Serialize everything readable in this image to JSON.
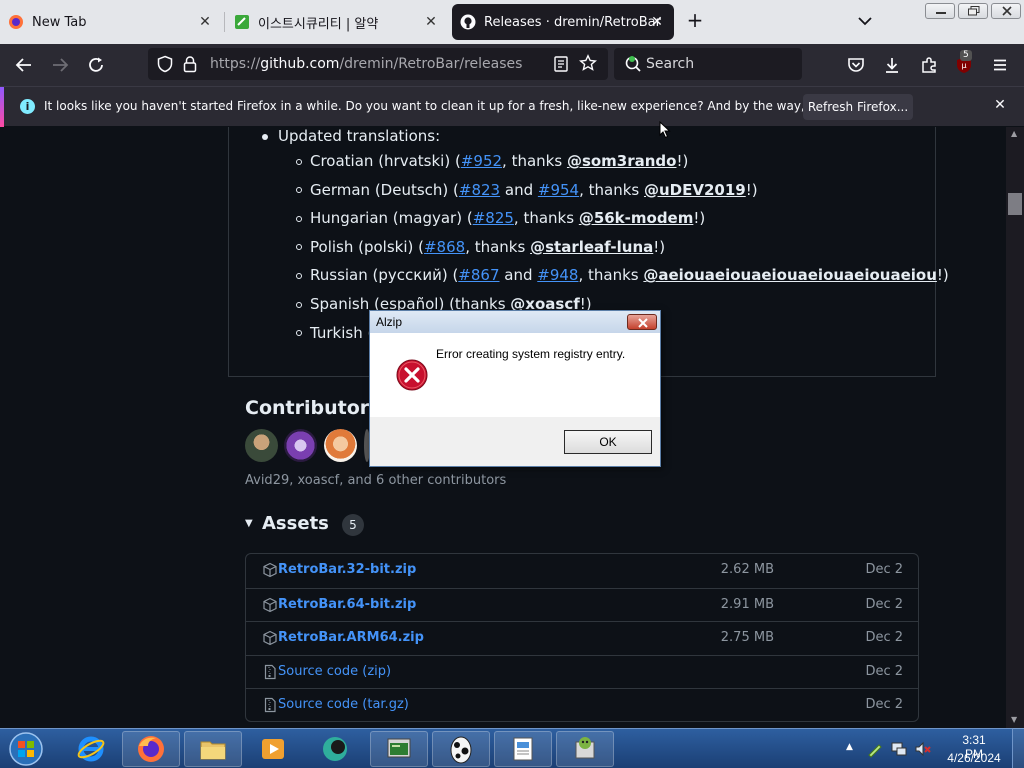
{
  "browser": {
    "tabs": [
      {
        "title": "New Tab",
        "icon": "firefox-icon"
      },
      {
        "title": "이스트시큐리티 | 알약",
        "icon": "alyac-icon"
      },
      {
        "title": "Releases · dremin/RetroBar",
        "icon": "github-icon",
        "active": true
      }
    ],
    "url": {
      "prefix": "https://",
      "host": "github.com",
      "path": "/dremin/RetroBar/releases"
    },
    "search_placeholder": "Search",
    "ublock_badge": "5",
    "notification": {
      "message": "It looks like you haven't started Firefox in a while. Do you want to clean it up for a fresh, like-new experience? And by the way, welcome back!",
      "button": "Refresh Firefox..."
    }
  },
  "release_notes": {
    "heading": "Updated translations:",
    "translations": [
      {
        "lang": "Croatian (hrvatski) (",
        "issues": [
          "#952"
        ],
        "mid": [],
        "thanks": ", thanks ",
        "user": "@som3rando",
        "end": "!)"
      },
      {
        "lang": "German (Deutsch) (",
        "issues": [
          "#823",
          "#954"
        ],
        "mid": [
          " and "
        ],
        "thanks": ", thanks ",
        "user": "@uDEV2019",
        "end": "!)"
      },
      {
        "lang": "Hungarian (magyar) (",
        "issues": [
          "#825"
        ],
        "mid": [],
        "thanks": ", thanks ",
        "user": "@56k-modem",
        "end": "!)"
      },
      {
        "lang": "Polish (polski) (",
        "issues": [
          "#868"
        ],
        "mid": [],
        "thanks": ", thanks ",
        "user": "@starleaf-luna",
        "end": "!)"
      },
      {
        "lang": "Russian (русский) (",
        "issues": [
          "#867",
          "#948"
        ],
        "mid": [
          " and "
        ],
        "thanks": ", thanks ",
        "user": "@aeiouaeiouaeiouaeiouaeiouaeiou",
        "end": "!)"
      },
      {
        "lang": "Spanish (español) (thanks ",
        "issues": [],
        "mid": [],
        "thanks": "",
        "user": "@xoascf",
        "end": "!)"
      },
      {
        "lang": "Turkish (",
        "issues": [],
        "mid": [],
        "thanks": "",
        "user": "",
        "end": ""
      }
    ]
  },
  "contributors": {
    "title": "Contributors",
    "summary": "Avid29, xoascf, and 6 other contributors"
  },
  "assets": {
    "title": "Assets",
    "count": "5",
    "rows": [
      {
        "name": "RetroBar.32-bit.zip",
        "sub": "",
        "size": "2.62 MB",
        "date": "Dec 2",
        "icon": "package-icon"
      },
      {
        "name": "RetroBar.64-bit.zip",
        "sub": "",
        "size": "2.91 MB",
        "date": "Dec 2",
        "icon": "package-icon"
      },
      {
        "name": "RetroBar.ARM64.zip",
        "sub": "",
        "size": "2.75 MB",
        "date": "Dec 2",
        "icon": "package-icon"
      },
      {
        "name": "Source code",
        "sub": " (zip)",
        "size": "",
        "date": "Dec 2",
        "icon": "file-zip-icon"
      },
      {
        "name": "Source code",
        "sub": " (tar.gz)",
        "size": "",
        "date": "Dec 2",
        "icon": "file-zip-icon"
      }
    ]
  },
  "dialog": {
    "title": "Alzip",
    "message": "Error creating system registry entry.",
    "ok": "OK"
  },
  "taskbar": {
    "time": "3:31 PM",
    "date": "4/26/2024"
  },
  "colors": {
    "link": "#4493f8",
    "page_bg": "#0d1117",
    "toolbar_bg": "#2b2a33"
  }
}
